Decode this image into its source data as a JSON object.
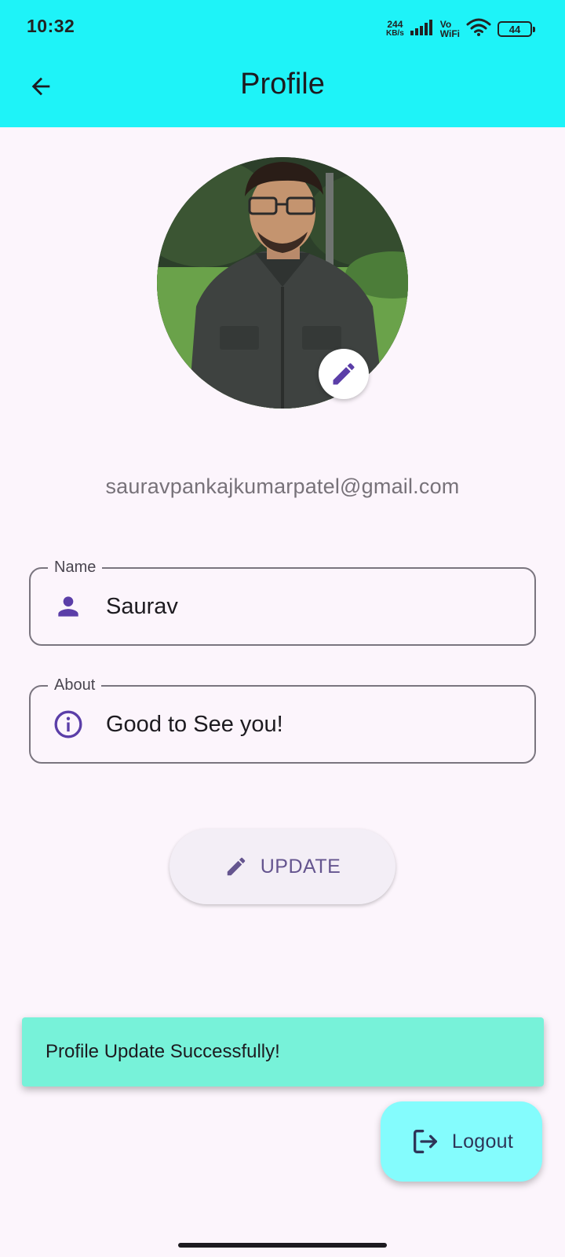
{
  "status_bar": {
    "time": "10:32",
    "net_speed_value": "244",
    "net_speed_unit": "KB/s",
    "vo_label": "Vo",
    "wifi_label": "WiFi",
    "battery_level": "44"
  },
  "app_bar": {
    "title": "Profile",
    "back_icon": "arrow-left-icon",
    "background_color": "#1ef3f8"
  },
  "profile": {
    "email": "sauravpankajkumarpatel@gmail.com",
    "edit_photo_icon": "pencil-icon"
  },
  "form": {
    "name": {
      "label": "Name",
      "value": "Saurav",
      "icon": "person-icon"
    },
    "about": {
      "label": "About",
      "value": "Good to See you!",
      "icon": "info-icon"
    }
  },
  "update_button": {
    "label": "UPDATE",
    "icon": "pencil-icon"
  },
  "snackbar": {
    "message": "Profile Update Successfully!",
    "color": "#77f2d9"
  },
  "logout_button": {
    "label": "Logout",
    "icon": "logout-icon",
    "color": "#84fcfd"
  },
  "accent_color": "#5b3ea8"
}
